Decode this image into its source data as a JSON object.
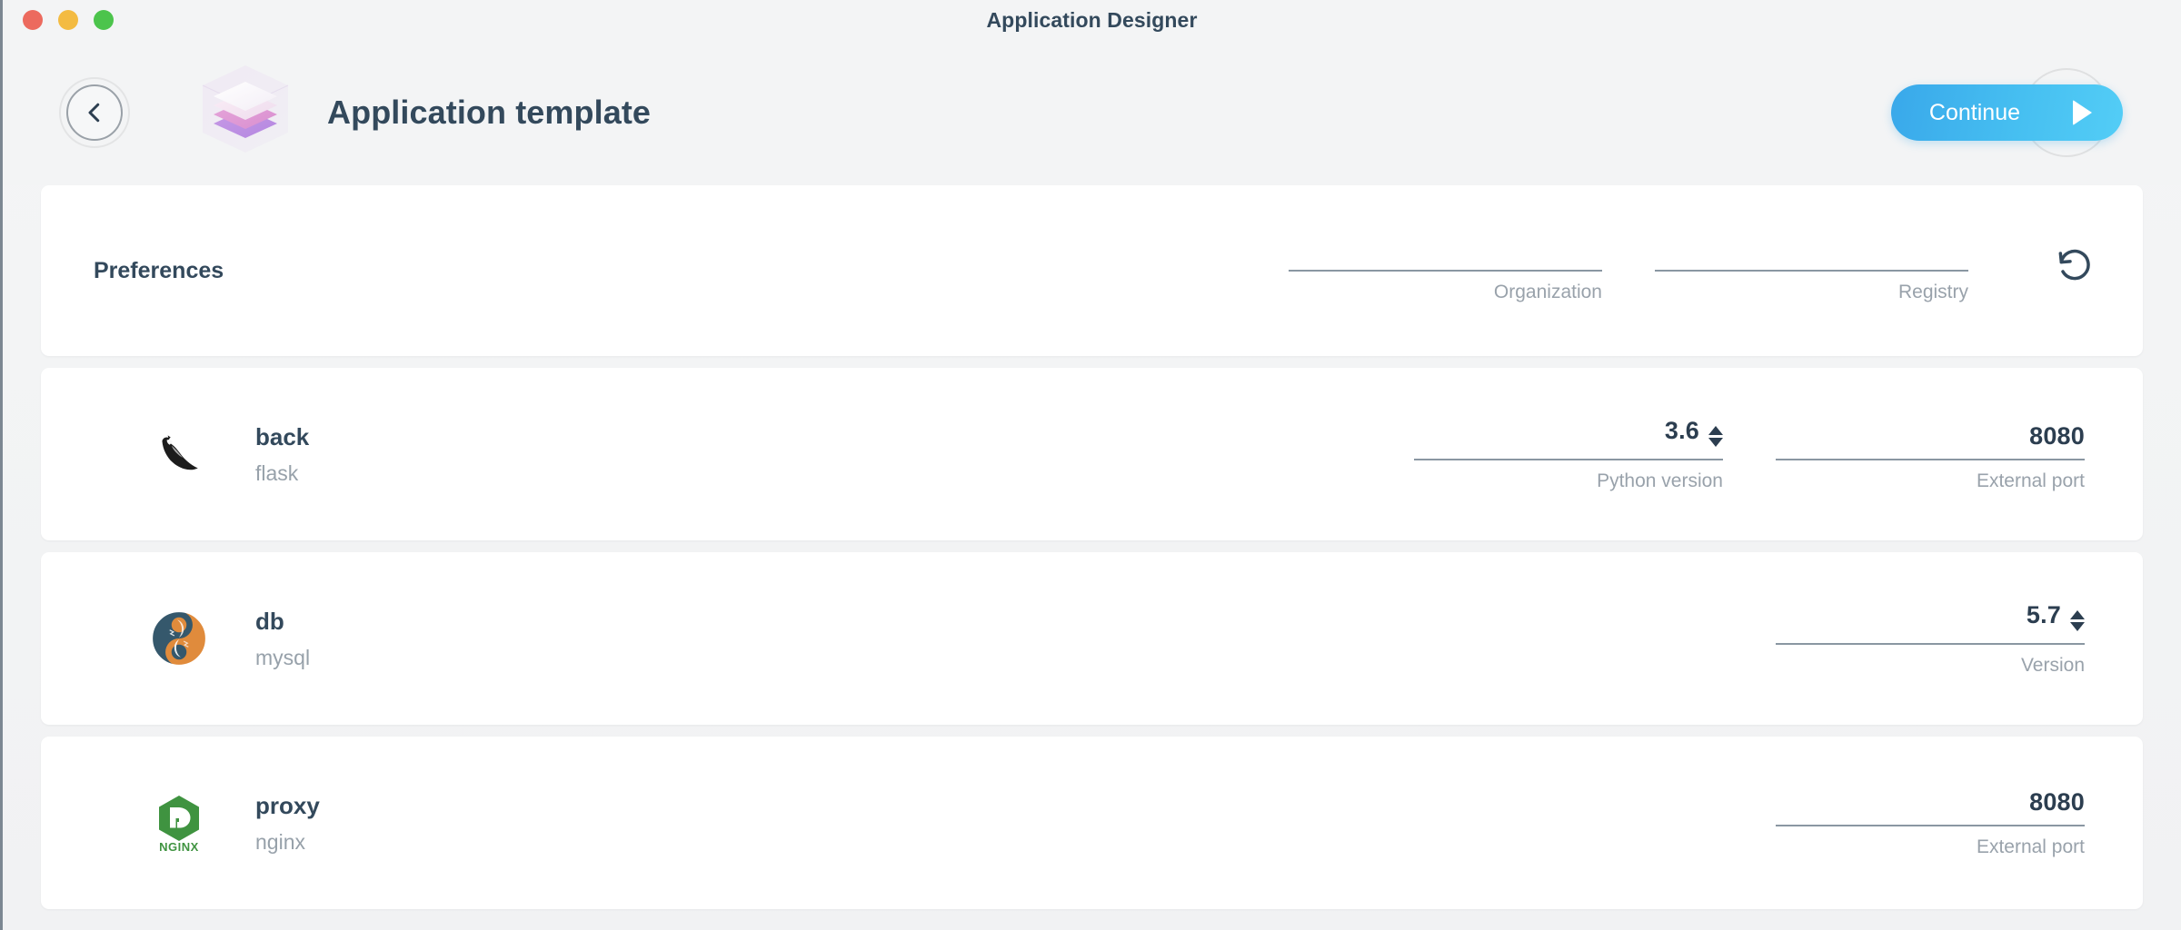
{
  "window": {
    "title": "Application Designer",
    "traffic_lights": [
      {
        "name": "close",
        "color": "#ec6a5e"
      },
      {
        "name": "minimize",
        "color": "#f3bb42"
      },
      {
        "name": "zoom",
        "color": "#4cc44c"
      }
    ]
  },
  "header": {
    "back_icon": "chevron-left-icon",
    "logo_icon": "layer-stack-icon",
    "title": "Application template",
    "continue_label": "Continue",
    "continue_icon": "play-triangle-icon",
    "accent_color": "#46bff1"
  },
  "preferences": {
    "title": "Preferences",
    "fields": [
      {
        "label": "Organization",
        "value": "",
        "placeholder": ""
      },
      {
        "label": "Registry",
        "value": "",
        "placeholder": ""
      }
    ],
    "reset_icon": "reset-rotate-ccw-icon"
  },
  "services": [
    {
      "name": "back",
      "image": "flask",
      "icon": "flask-logo-icon",
      "fields": [
        {
          "label": "Python version",
          "value": "3.6",
          "stepper": true
        },
        {
          "label": "External port",
          "value": "8080",
          "stepper": false
        }
      ]
    },
    {
      "name": "db",
      "image": "mysql",
      "icon": "mysql-logo-icon",
      "fields": [
        {
          "label": "Version",
          "value": "5.7",
          "stepper": true
        }
      ]
    },
    {
      "name": "proxy",
      "image": "nginx",
      "icon": "nginx-logo-icon",
      "fields": [
        {
          "label": "External port",
          "value": "8080",
          "stepper": false
        }
      ]
    }
  ],
  "colors": {
    "background": "#f2f3f4",
    "card": "#ffffff",
    "text_primary": "#33495c",
    "text_muted": "#99a2ab",
    "underline": "#8a97a2"
  }
}
